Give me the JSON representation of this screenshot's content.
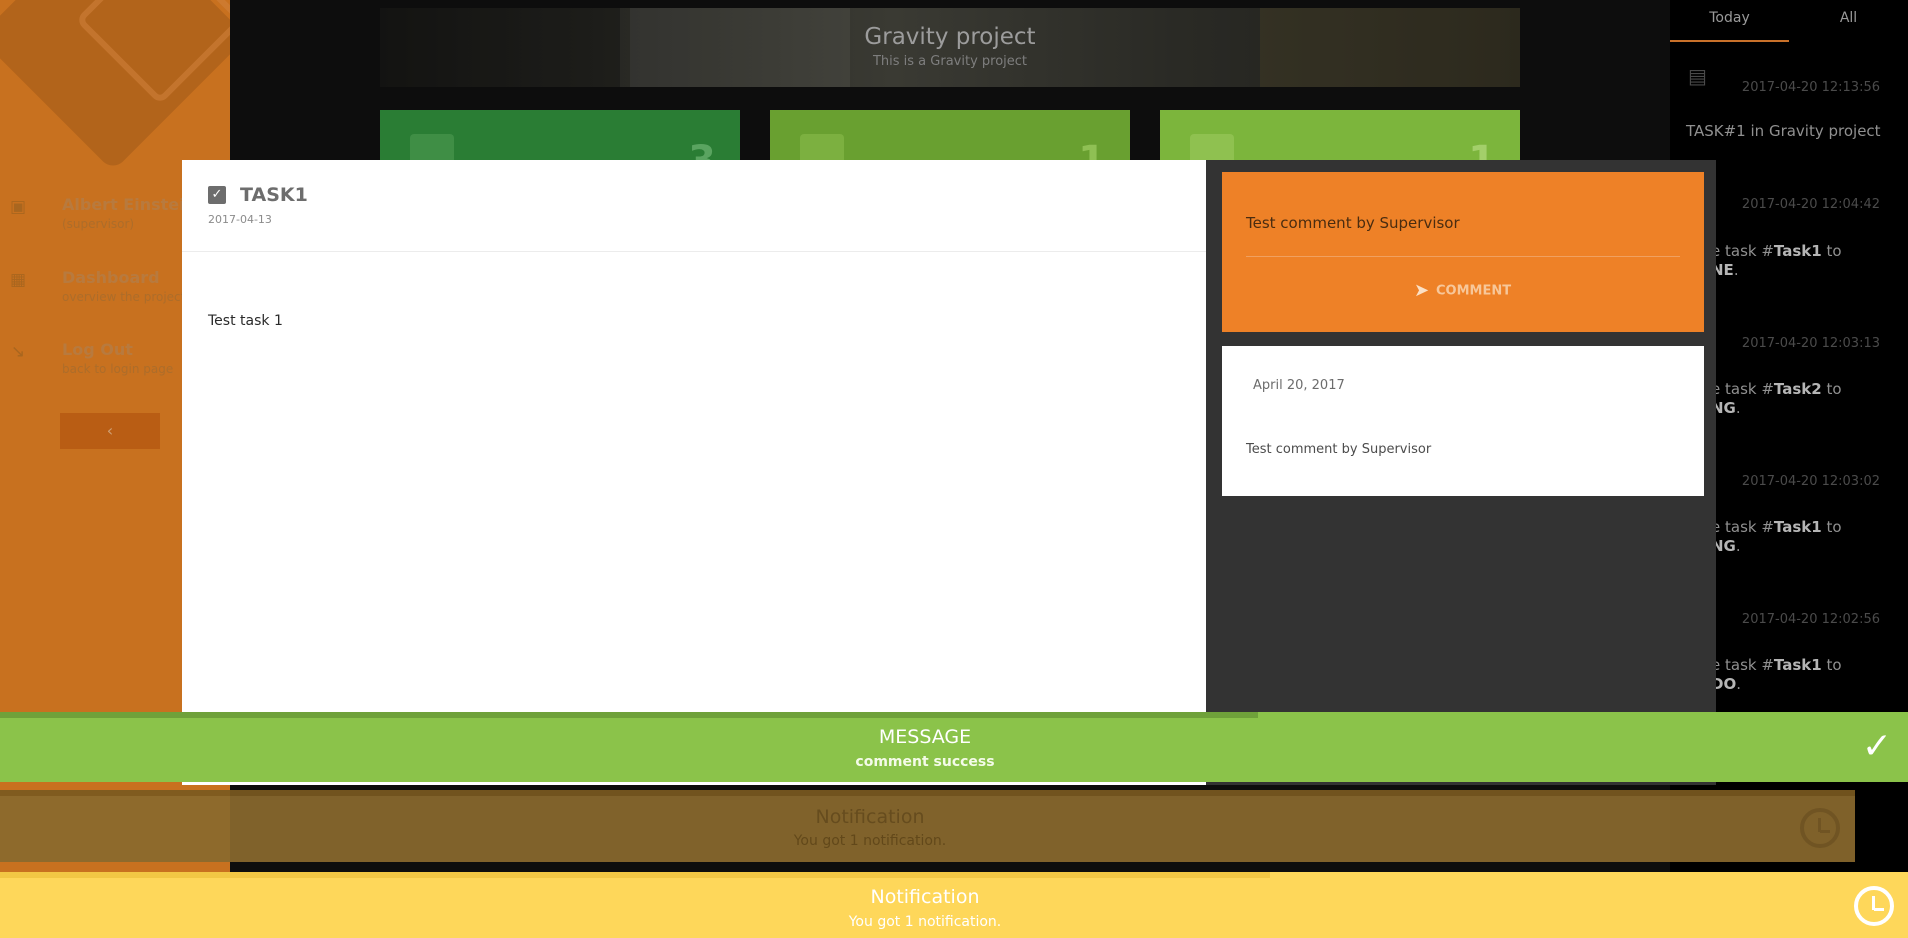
{
  "sidebar": {
    "user": {
      "name": "Albert Einstein",
      "role": "(supervisor)"
    },
    "items": [
      {
        "label": "Dashboard",
        "sub": "overview the project"
      },
      {
        "label": "Log Out",
        "sub": "back to login page"
      }
    ],
    "collapse_label": "‹"
  },
  "project": {
    "title": "Gravity project",
    "subtitle": "This is a Gravity project",
    "stats": [
      {
        "value": "3",
        "color": "#2a7d34"
      },
      {
        "value": "1",
        "color": "#69a030"
      },
      {
        "value": "1",
        "color": "#7cb53c"
      }
    ]
  },
  "activity": {
    "tabs": [
      "Today",
      "All"
    ],
    "entries": [
      {
        "time": "2017-04-20 12:13:56",
        "text": "TASK#1 in Gravity project"
      },
      {
        "time": "2017-04-20 12:04:42",
        "prefix": "e task #",
        "task": "Task1",
        "to": " to",
        "status": "NE",
        "end": "."
      },
      {
        "time": "2017-04-20 12:03:13",
        "prefix": "e task #",
        "task": "Task2",
        "to": " to",
        "status": "NG",
        "end": "."
      },
      {
        "time": "2017-04-20 12:03:02",
        "prefix": "e task #",
        "task": "Task1",
        "to": " to",
        "status": "NG",
        "end": "."
      },
      {
        "time": "2017-04-20 12:02:56",
        "prefix": "e task #",
        "task": "Task1",
        "to": " to",
        "status": "DO",
        "end": "."
      }
    ]
  },
  "modal": {
    "task_title": "TASK1",
    "task_date": "2017-04-13",
    "task_description": "Test task 1",
    "comment_input_value": "Test comment by Supervisor",
    "comment_button": "COMMENT",
    "comments": [
      {
        "date": "April 20, 2017",
        "text": "Test comment by Supervisor"
      }
    ]
  },
  "toasts": {
    "message": {
      "title": "MESSAGE",
      "body": "comment success",
      "color": "#8bc34a"
    },
    "notification_dim": {
      "title": "Notification",
      "body": "You got 1 notification."
    },
    "notification": {
      "title": "Notification",
      "body": "You got 1 notification.",
      "color": "#fed75a"
    }
  }
}
